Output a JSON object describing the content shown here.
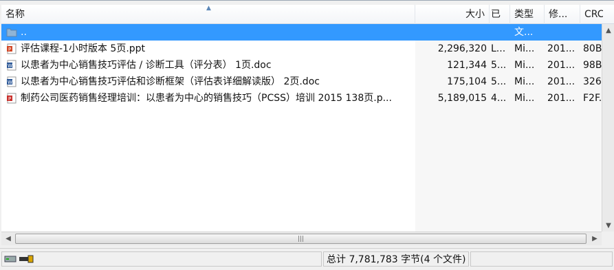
{
  "header": {
    "columns": {
      "name": "名称",
      "size": "大小",
      "packed": "已",
      "type": "类型",
      "modified": "修...",
      "crc": "CRC..."
    }
  },
  "files": [
    {
      "name": "..",
      "size": "",
      "packed": "",
      "type": "文...",
      "modified": "",
      "crc": "",
      "icon": "folder-icon",
      "selected": true
    },
    {
      "name": "评估课程-1小时版本 5页.ppt",
      "size": "2,296,320",
      "packed": "L...",
      "type": "Mi...",
      "modified": "201...",
      "crc": "80B...",
      "icon": "ppt-file-icon"
    },
    {
      "name": "以患者为中心销售技巧评估 / 诊断工具（评分表） 1页.doc",
      "size": "121,344",
      "packed": "5...",
      "type": "Mi...",
      "modified": "201...",
      "crc": "98B...",
      "icon": "doc-file-icon"
    },
    {
      "name": "以患者为中心销售技巧评估和诊断框架（评估表详细解读版） 2页.doc",
      "size": "175,104",
      "packed": "5...",
      "type": "Mi...",
      "modified": "201...",
      "crc": "326...",
      "icon": "doc-file-icon"
    },
    {
      "name": "制药公司医药销售经理培训：以患者为中心的销售技巧（PCSS）培训 2015 138页.p...",
      "size": "5,189,015",
      "packed": "4...",
      "type": "Mi...",
      "modified": "201...",
      "crc": "F2F...",
      "icon": "pdf-file-icon"
    }
  ],
  "status": {
    "total": "总计 7,781,783 字节(4 个文件)"
  },
  "colors": {
    "selection": "#3399ff",
    "background": "#ffffff"
  }
}
